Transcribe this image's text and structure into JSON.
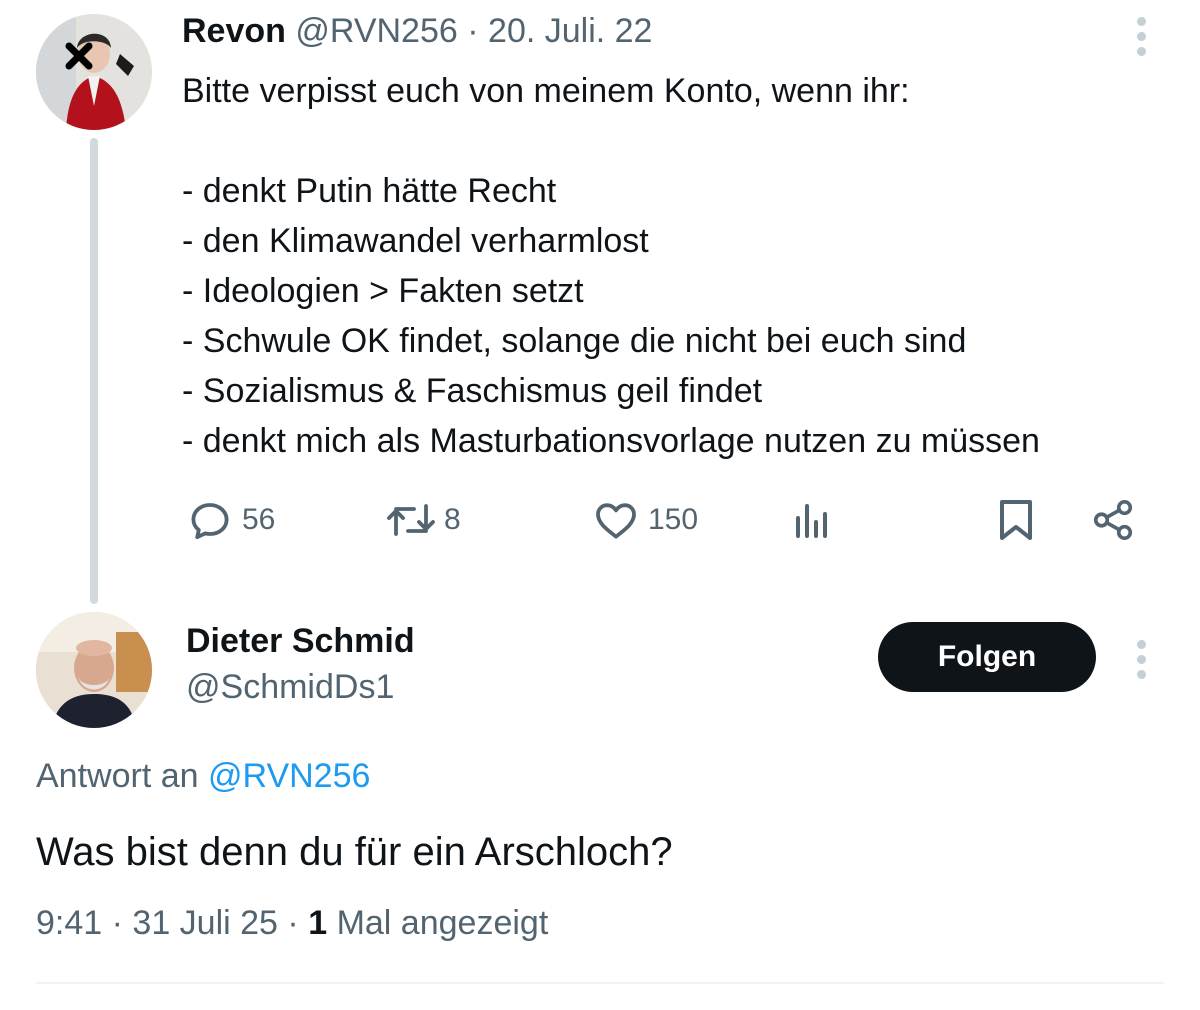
{
  "parent_tweet": {
    "display_name": "Revon",
    "handle": "@RVN256",
    "separator": "·",
    "date": "20. Juli. 22",
    "lines": [
      "Bitte verpisst euch von meinem Konto, wenn ihr:",
      "",
      "- denkt Putin hätte Recht",
      "- den Klimawandel verharmlost",
      "- Ideologien > Fakten setzt",
      "- Schwule OK findet, solange die nicht bei euch sind",
      "- Sozialismus & Faschismus geil findet",
      "- denkt mich als Masturbationsvorlage nutzen zu müssen"
    ],
    "stats": {
      "replies": "56",
      "retweets": "8",
      "likes": "150"
    },
    "icons": [
      "reply-icon",
      "retweet-icon",
      "like-icon",
      "views-icon",
      "bookmark-icon",
      "share-icon"
    ]
  },
  "reply_tweet": {
    "display_name": "Dieter Schmid",
    "handle": "@SchmidDs1",
    "follow_label": "Folgen",
    "reply_to_label": "Antwort an",
    "reply_to_handle": "@RVN256",
    "text": "Was bist denn du für ein Arschloch?",
    "time": "9:41",
    "separator": "·",
    "date": "31 Juli 25",
    "view_count": "1",
    "view_label": "Mal angezeigt"
  },
  "colors": {
    "text": "#0f1419",
    "muted": "#536471",
    "link": "#1d9bf0",
    "thread_line": "#cfd9de",
    "button_bg": "#0f1419"
  }
}
